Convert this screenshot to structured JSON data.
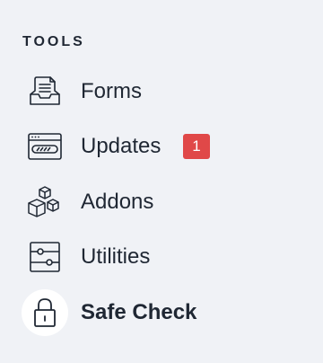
{
  "section": {
    "title": "TOOLS"
  },
  "colors": {
    "background": "#f0f2f6",
    "text": "#1f2733",
    "badge": "#e04848",
    "active_icon_bg": "#ffffff"
  },
  "nav": {
    "items": [
      {
        "label": "Forms",
        "icon": "inbox-form-icon"
      },
      {
        "label": "Updates",
        "icon": "update-progress-icon",
        "badge": "1"
      },
      {
        "label": "Addons",
        "icon": "cubes-icon"
      },
      {
        "label": "Utilities",
        "icon": "sliders-icon"
      },
      {
        "label": "Safe Check",
        "icon": "lock-icon",
        "active": true
      }
    ]
  }
}
